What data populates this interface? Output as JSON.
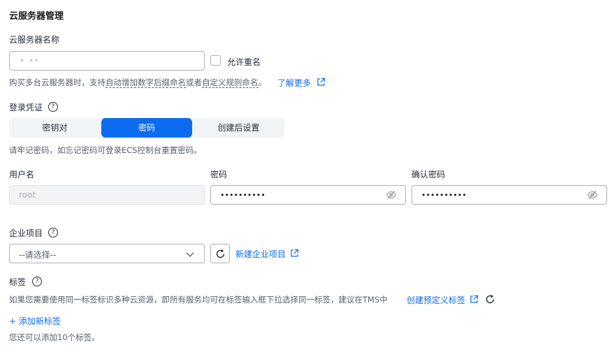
{
  "section_title": "云服务器管理",
  "server_name": {
    "label": "云服务器名称",
    "value": "•  ••",
    "allow_duplicate_label": "允许重名"
  },
  "name_hint": {
    "prefix": "购买多台云服务器时，支持",
    "auto_increment": "自动增加数字后缀命名",
    "or": "或者",
    "custom_rule": "自定义规则命名",
    "end": "。",
    "learn_more": "了解更多"
  },
  "login_credential": {
    "label": "登录凭证",
    "help": "?",
    "tabs": [
      "密钥对",
      "密码",
      "创建后设置"
    ],
    "active_tab": "密码",
    "hint": "请牢记密码，如忘记密码可登录ECS控制台重置密码。"
  },
  "fields": {
    "username_label": "用户名",
    "username_value": "root",
    "password_label": "密码",
    "password_value": "••••••••••",
    "confirm_label": "确认密码",
    "confirm_value": "••••••••••"
  },
  "enterprise": {
    "label": "企业项目",
    "help": "?",
    "placeholder": "--请选择--",
    "new_link": "新建企业项目"
  },
  "tags": {
    "label": "标签",
    "help": "?",
    "hint": "如果您需要使用同一标签标识多种云资源，即所有服务均可在标签输入框下拉选择同一标签，建议在TMS中",
    "create_link": "创建预定义标签",
    "add_link": "+ 添加新标签",
    "remaining": "您还可以添加10个标签。"
  },
  "icons": {
    "external": "external-link-icon",
    "eye_off": "eye-off-icon",
    "refresh": "refresh-icon",
    "chevron": "chevron-down-icon"
  },
  "colors": {
    "accent": "#0b6cf0",
    "border": "#adb0b8",
    "segment_bg": "#f1f3f5",
    "disabled_bg": "#f1f3f5"
  }
}
